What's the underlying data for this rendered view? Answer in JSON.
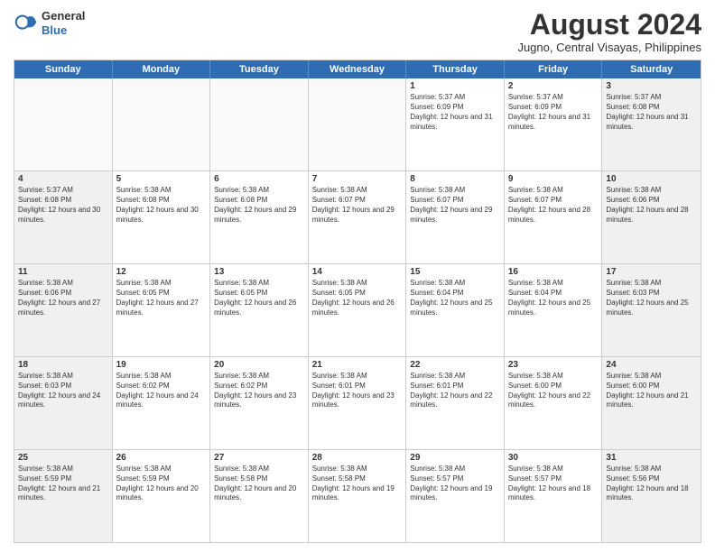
{
  "logo": {
    "general": "General",
    "blue": "Blue"
  },
  "header": {
    "title": "August 2024",
    "subtitle": "Jugno, Central Visayas, Philippines"
  },
  "days": [
    "Sunday",
    "Monday",
    "Tuesday",
    "Wednesday",
    "Thursday",
    "Friday",
    "Saturday"
  ],
  "rows": [
    [
      {
        "day": "",
        "empty": true
      },
      {
        "day": "",
        "empty": true
      },
      {
        "day": "",
        "empty": true
      },
      {
        "day": "",
        "empty": true
      },
      {
        "day": "1",
        "sunrise": "5:37 AM",
        "sunset": "6:09 PM",
        "daylight": "12 hours and 31 minutes."
      },
      {
        "day": "2",
        "sunrise": "5:37 AM",
        "sunset": "6:09 PM",
        "daylight": "12 hours and 31 minutes."
      },
      {
        "day": "3",
        "sunrise": "5:37 AM",
        "sunset": "6:08 PM",
        "daylight": "12 hours and 31 minutes."
      }
    ],
    [
      {
        "day": "4",
        "sunrise": "5:37 AM",
        "sunset": "6:08 PM",
        "daylight": "12 hours and 30 minutes."
      },
      {
        "day": "5",
        "sunrise": "5:38 AM",
        "sunset": "6:08 PM",
        "daylight": "12 hours and 30 minutes."
      },
      {
        "day": "6",
        "sunrise": "5:38 AM",
        "sunset": "6:08 PM",
        "daylight": "12 hours and 29 minutes."
      },
      {
        "day": "7",
        "sunrise": "5:38 AM",
        "sunset": "6:07 PM",
        "daylight": "12 hours and 29 minutes."
      },
      {
        "day": "8",
        "sunrise": "5:38 AM",
        "sunset": "6:07 PM",
        "daylight": "12 hours and 29 minutes."
      },
      {
        "day": "9",
        "sunrise": "5:38 AM",
        "sunset": "6:07 PM",
        "daylight": "12 hours and 28 minutes."
      },
      {
        "day": "10",
        "sunrise": "5:38 AM",
        "sunset": "6:06 PM",
        "daylight": "12 hours and 28 minutes."
      }
    ],
    [
      {
        "day": "11",
        "sunrise": "5:38 AM",
        "sunset": "6:06 PM",
        "daylight": "12 hours and 27 minutes."
      },
      {
        "day": "12",
        "sunrise": "5:38 AM",
        "sunset": "6:05 PM",
        "daylight": "12 hours and 27 minutes."
      },
      {
        "day": "13",
        "sunrise": "5:38 AM",
        "sunset": "6:05 PM",
        "daylight": "12 hours and 26 minutes."
      },
      {
        "day": "14",
        "sunrise": "5:38 AM",
        "sunset": "6:05 PM",
        "daylight": "12 hours and 26 minutes."
      },
      {
        "day": "15",
        "sunrise": "5:38 AM",
        "sunset": "6:04 PM",
        "daylight": "12 hours and 25 minutes."
      },
      {
        "day": "16",
        "sunrise": "5:38 AM",
        "sunset": "6:04 PM",
        "daylight": "12 hours and 25 minutes."
      },
      {
        "day": "17",
        "sunrise": "5:38 AM",
        "sunset": "6:03 PM",
        "daylight": "12 hours and 25 minutes."
      }
    ],
    [
      {
        "day": "18",
        "sunrise": "5:38 AM",
        "sunset": "6:03 PM",
        "daylight": "12 hours and 24 minutes."
      },
      {
        "day": "19",
        "sunrise": "5:38 AM",
        "sunset": "6:02 PM",
        "daylight": "12 hours and 24 minutes."
      },
      {
        "day": "20",
        "sunrise": "5:38 AM",
        "sunset": "6:02 PM",
        "daylight": "12 hours and 23 minutes."
      },
      {
        "day": "21",
        "sunrise": "5:38 AM",
        "sunset": "6:01 PM",
        "daylight": "12 hours and 23 minutes."
      },
      {
        "day": "22",
        "sunrise": "5:38 AM",
        "sunset": "6:01 PM",
        "daylight": "12 hours and 22 minutes."
      },
      {
        "day": "23",
        "sunrise": "5:38 AM",
        "sunset": "6:00 PM",
        "daylight": "12 hours and 22 minutes."
      },
      {
        "day": "24",
        "sunrise": "5:38 AM",
        "sunset": "6:00 PM",
        "daylight": "12 hours and 21 minutes."
      }
    ],
    [
      {
        "day": "25",
        "sunrise": "5:38 AM",
        "sunset": "5:59 PM",
        "daylight": "12 hours and 21 minutes."
      },
      {
        "day": "26",
        "sunrise": "5:38 AM",
        "sunset": "5:59 PM",
        "daylight": "12 hours and 20 minutes."
      },
      {
        "day": "27",
        "sunrise": "5:38 AM",
        "sunset": "5:58 PM",
        "daylight": "12 hours and 20 minutes."
      },
      {
        "day": "28",
        "sunrise": "5:38 AM",
        "sunset": "5:58 PM",
        "daylight": "12 hours and 19 minutes."
      },
      {
        "day": "29",
        "sunrise": "5:38 AM",
        "sunset": "5:57 PM",
        "daylight": "12 hours and 19 minutes."
      },
      {
        "day": "30",
        "sunrise": "5:38 AM",
        "sunset": "5:57 PM",
        "daylight": "12 hours and 18 minutes."
      },
      {
        "day": "31",
        "sunrise": "5:38 AM",
        "sunset": "5:56 PM",
        "daylight": "12 hours and 18 minutes."
      }
    ]
  ]
}
